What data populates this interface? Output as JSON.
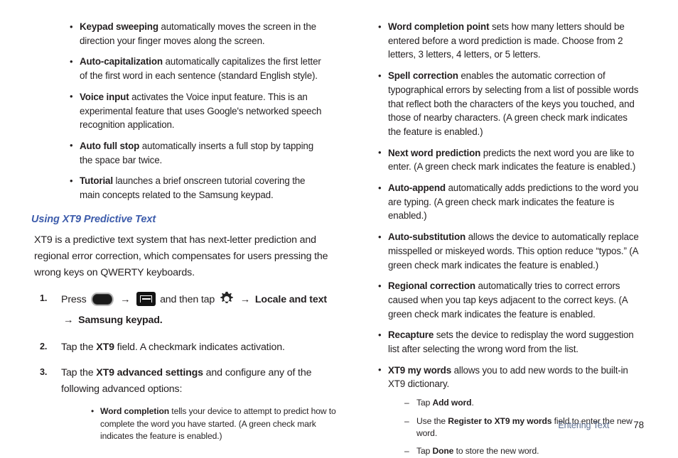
{
  "document": {
    "page_number": "78",
    "footer_label": "Entering Text"
  },
  "left_column": {
    "top_bullets": [
      {
        "term": "Keypad sweeping",
        "text": " automatically moves the screen in the direction your finger moves along the screen."
      },
      {
        "term": "Auto-capitalization",
        "text": " automatically capitalizes the first letter of the first word in each sentence (standard English style)."
      },
      {
        "term": "Voice input",
        "text": " activates the Voice input feature. This is an experimental feature that uses Google's networked speech recognition application."
      },
      {
        "term": "Auto full stop",
        "text": " automatically inserts a full stop by tapping the space bar twice."
      },
      {
        "term": "Tutorial",
        "text": " launches a brief onscreen tutorial covering the main concepts related to the Samsung keypad."
      }
    ],
    "heading": "Using XT9 Predictive Text",
    "intro_paragraph": "XT9 is a predictive text system that has next-letter prediction and regional error correction, which compensates for users pressing the wrong keys on QWERTY keyboards.",
    "steps": [
      {
        "number": "1.",
        "lead": "Press",
        "icon_home": "home-key-icon",
        "arrow_1": "→",
        "icon_menu": "menu-key-icon",
        "middle": "and then tap",
        "icon_gear": "gear-icon",
        "arrow_2": "→",
        "bold_1": "Locale and text",
        "arrow_3": "→",
        "bold_2": "Samsung keypad."
      },
      {
        "number": "2.",
        "pre": "Tap the ",
        "bold": "XT9",
        "post": " field. A checkmark indicates activation."
      },
      {
        "number": "3.",
        "pre": "Tap the ",
        "bold": "XT9 advanced settings",
        "post": " and configure any of the following advanced options:"
      }
    ],
    "sub_bullets": [
      {
        "term": "Word completion",
        "text": "  tells your device to attempt to predict how to complete the word you have started. (A green check mark indicates the feature is enabled.)"
      }
    ]
  },
  "right_column": {
    "bullets": [
      {
        "term": "Word completion point",
        "text": " sets how many letters should be entered before a word prediction is made. Choose from 2 letters, 3 letters, 4 letters, or 5 letters."
      },
      {
        "term": "Spell correction",
        "text": " enables the automatic correction of typographical errors by selecting from a list of possible words that reflect both the characters of the keys you touched, and those of nearby characters. (A green check mark indicates the feature is enabled.)"
      },
      {
        "term": "Next word prediction",
        "text": " predicts the next word you are like to enter. (A green check mark indicates the feature is enabled.)"
      },
      {
        "term": "Auto-append",
        "text": " automatically adds predictions to the word you are typing. (A green check mark indicates the feature is enabled.)"
      },
      {
        "term": "Auto-substitution",
        "text": " allows the device to automatically replace misspelled or miskeyed words. This option reduce “typos.” (A green check mark indicates the feature is enabled.)"
      },
      {
        "term": "Regional correction",
        "text": " automatically tries to correct errors caused when you tap keys adjacent to the correct keys. (A green check mark indicates the feature is enabled."
      },
      {
        "term": "Recapture",
        "text": " sets the device to redisplay the word suggestion list after selecting the wrong word from the list."
      },
      {
        "term": "XT9 my words",
        "text": " allows you to add new words to the built-in XT9 dictionary."
      }
    ],
    "dash_items": [
      {
        "pre": "Tap ",
        "bold": "Add word",
        "post": "."
      },
      {
        "pre": "Use the ",
        "bold": "Register to XT9 my words",
        "post": " field to enter the new word."
      },
      {
        "pre": "Tap ",
        "bold": "Done",
        "post": " to store the new word."
      }
    ]
  },
  "colors": {
    "heading_blue": "#3d5cab",
    "footer_blue": "#5d6f91",
    "body_text": "#231f20"
  }
}
